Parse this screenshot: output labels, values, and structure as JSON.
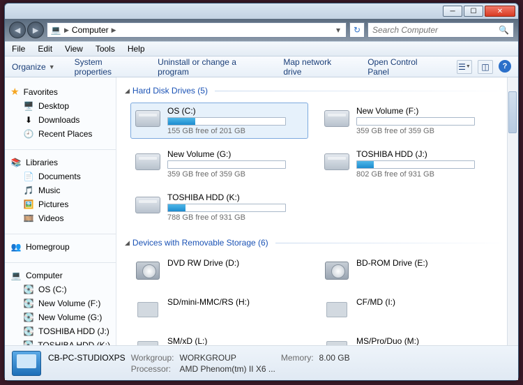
{
  "titlebar": {},
  "nav": {
    "breadcrumb_root": "Computer",
    "search_placeholder": "Search Computer"
  },
  "menubar": [
    "File",
    "Edit",
    "View",
    "Tools",
    "Help"
  ],
  "toolbar": {
    "organize": "Organize",
    "sysprops": "System properties",
    "uninstall": "Uninstall or change a program",
    "mapdrive": "Map network drive",
    "opencp": "Open Control Panel"
  },
  "sidebar": {
    "favorites": {
      "label": "Favorites",
      "items": [
        "Desktop",
        "Downloads",
        "Recent Places"
      ]
    },
    "libraries": {
      "label": "Libraries",
      "items": [
        "Documents",
        "Music",
        "Pictures",
        "Videos"
      ]
    },
    "homegroup": {
      "label": "Homegroup"
    },
    "computer": {
      "label": "Computer",
      "items": [
        "OS (C:)",
        "New Volume (F:)",
        "New Volume (G:)",
        "TOSHIBA HDD (J:)",
        "TOSHIBA HDD (K:)"
      ]
    }
  },
  "sections": {
    "hdd": {
      "label": "Hard Disk Drives (5)"
    },
    "removable": {
      "label": "Devices with Removable Storage (6)"
    }
  },
  "drives": [
    {
      "name": "OS (C:)",
      "free": "155 GB free of 201 GB",
      "pct": 23,
      "selected": true
    },
    {
      "name": "New Volume (F:)",
      "free": "359 GB free of 359 GB",
      "pct": 0
    },
    {
      "name": "New Volume (G:)",
      "free": "359 GB free of 359 GB",
      "pct": 0
    },
    {
      "name": "TOSHIBA HDD (J:)",
      "free": "802 GB free of 931 GB",
      "pct": 14
    },
    {
      "name": "TOSHIBA HDD (K:)",
      "free": "788 GB free of 931 GB",
      "pct": 15
    }
  ],
  "removable": [
    {
      "name": "DVD RW Drive (D:)",
      "kind": "dvd",
      "badge": "DVD"
    },
    {
      "name": "BD-ROM Drive (E:)",
      "kind": "dvd",
      "badge": "BD"
    },
    {
      "name": "SD/mini-MMC/RS (H:)",
      "kind": "card"
    },
    {
      "name": "CF/MD (I:)",
      "kind": "card"
    },
    {
      "name": "SM/xD (L:)",
      "kind": "card"
    },
    {
      "name": "MS/Pro/Duo (M:)",
      "kind": "card"
    }
  ],
  "details": {
    "name": "CB-PC-STUDIOXPS",
    "workgroup_k": "Workgroup:",
    "workgroup_v": "WORKGROUP",
    "memory_k": "Memory:",
    "memory_v": "8.00 GB",
    "processor_k": "Processor:",
    "processor_v": "AMD Phenom(tm) II X6 ..."
  }
}
